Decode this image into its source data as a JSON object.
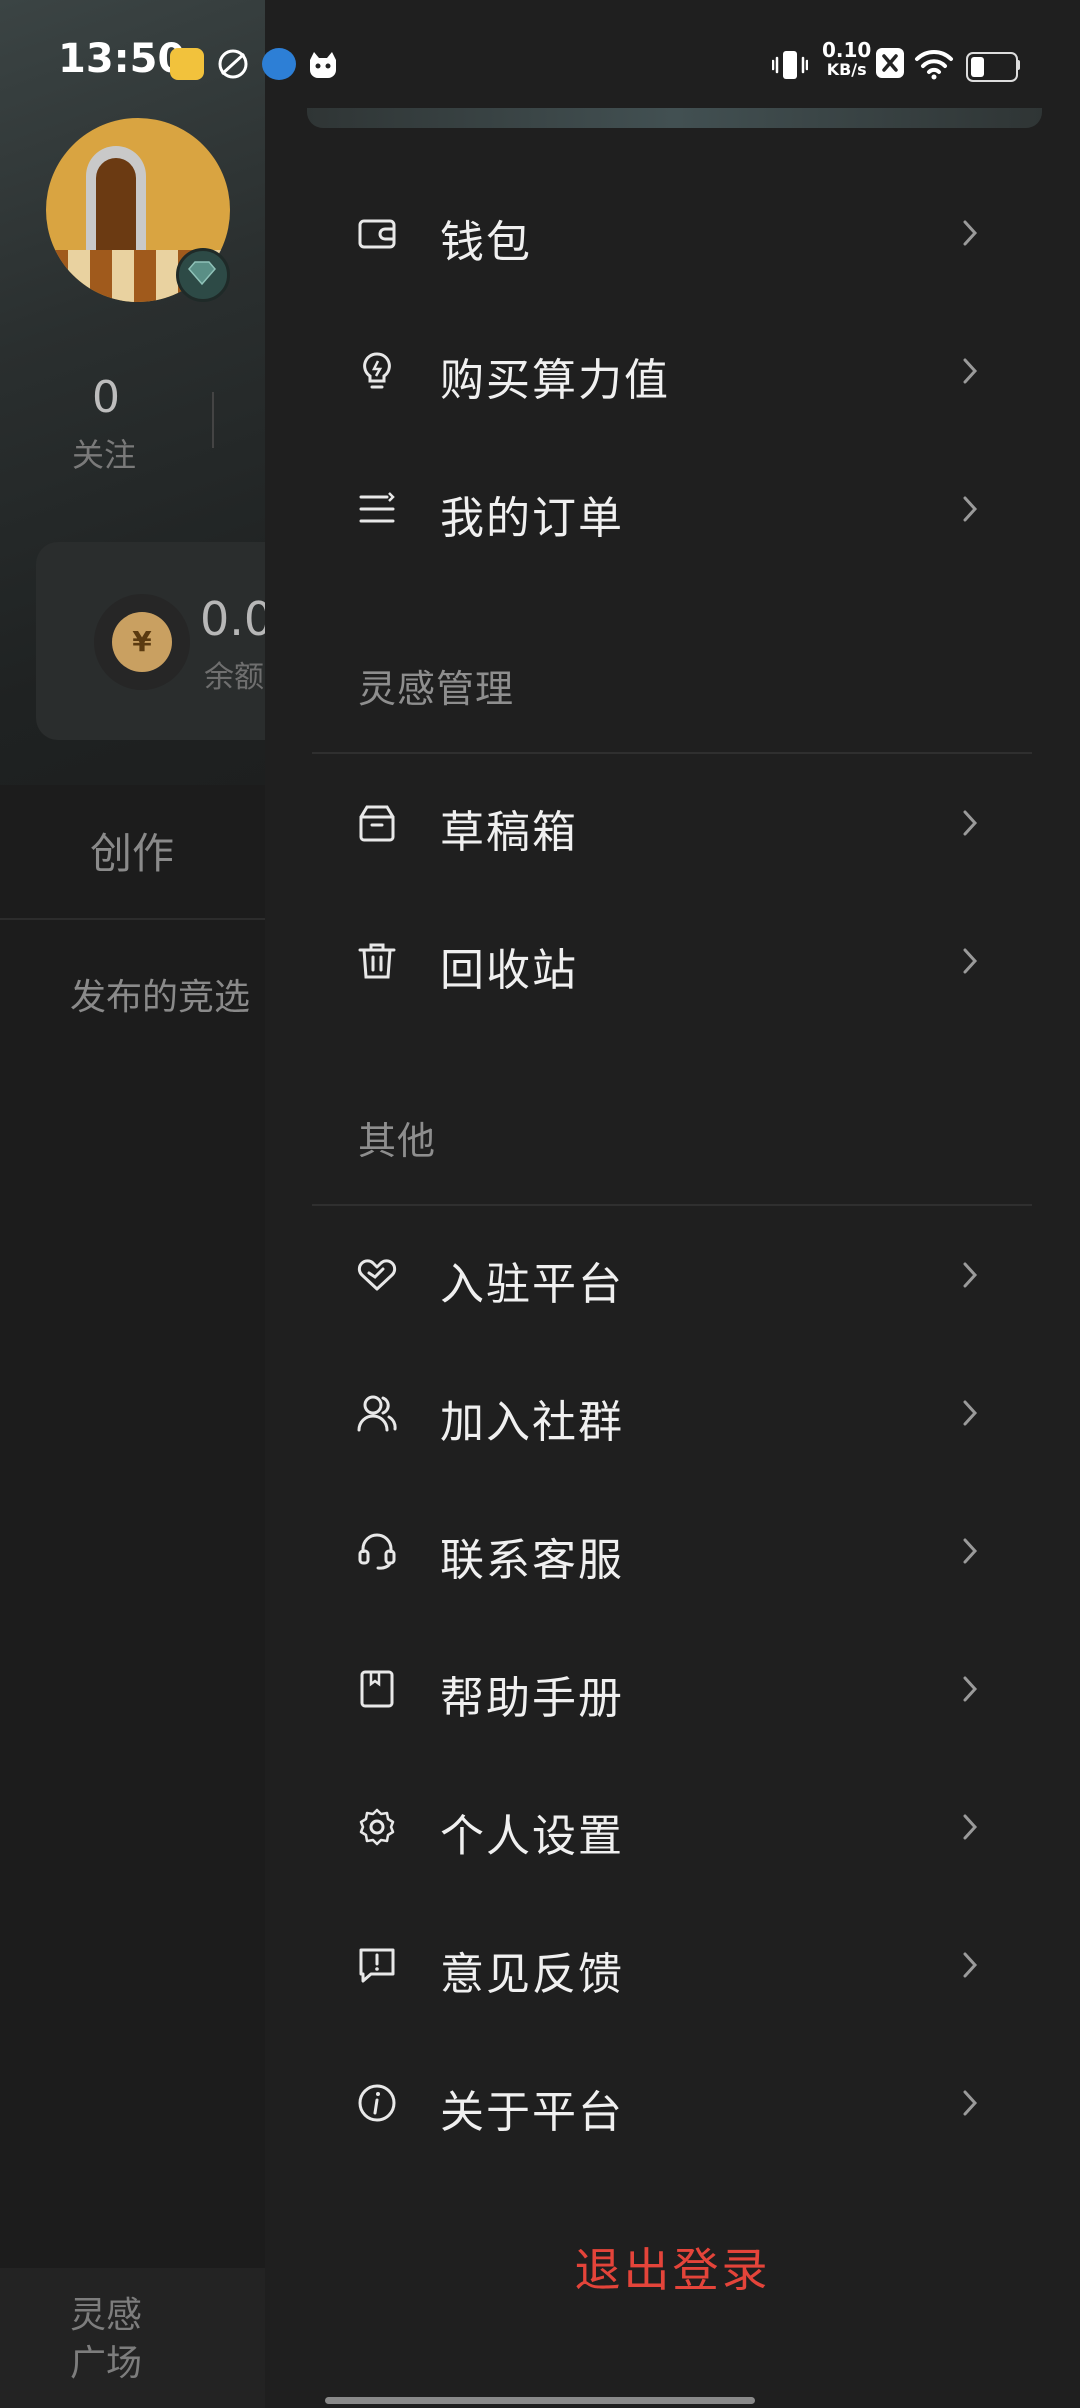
{
  "status_bar": {
    "time": "13:50",
    "net_speed_value": "0.10",
    "net_speed_unit": "KB/s",
    "battery_level": 0.3,
    "icons": [
      "xiaohongshu-app-icon",
      "orbit-app-icon",
      "browser-app-icon",
      "cat-app-icon",
      "vibrate-icon",
      "sim-x-icon",
      "wifi-icon",
      "battery-icon"
    ]
  },
  "background": {
    "follow_count": "0",
    "follow_label": "关注",
    "balance_amount": "0.0",
    "balance_label": "余额",
    "coin_symbol": "¥",
    "tab_create": "创作",
    "published_text": "发布的竞选",
    "bottom_nav_label": "灵感广场"
  },
  "drawer": {
    "items_top": [
      {
        "label": "钱包",
        "icon": "wallet-icon"
      },
      {
        "label": "购买算力值",
        "icon": "lightbulb-icon"
      },
      {
        "label": "我的订单",
        "icon": "orders-icon"
      }
    ],
    "section_inspiration": "灵感管理",
    "items_inspiration": [
      {
        "label": "草稿箱",
        "icon": "drafts-box-icon"
      },
      {
        "label": "回收站",
        "icon": "trash-icon"
      }
    ],
    "section_other": "其他",
    "items_other": [
      {
        "label": "入驻平台",
        "icon": "handshake-icon"
      },
      {
        "label": "加入社群",
        "icon": "group-icon"
      },
      {
        "label": "联系客服",
        "icon": "headset-icon"
      },
      {
        "label": "帮助手册",
        "icon": "manual-icon"
      },
      {
        "label": "个人设置",
        "icon": "gear-icon"
      },
      {
        "label": "意见反馈",
        "icon": "feedback-icon"
      },
      {
        "label": "关于平台",
        "icon": "info-icon"
      }
    ],
    "logout_label": "退出登录"
  },
  "colors": {
    "drawer_bg": "#1f1f1f",
    "logout_red": "#e4443a",
    "text_primary": "#f0f0f0",
    "section_gray": "#8e8e8e"
  }
}
